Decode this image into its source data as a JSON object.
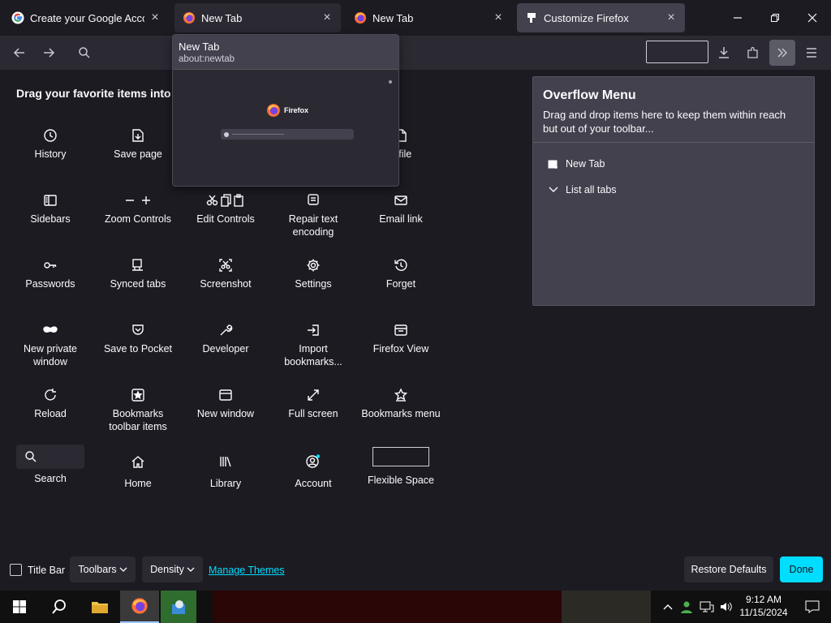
{
  "tabs": [
    {
      "label": "Create your Google Account",
      "icon": "google-icon",
      "state": "normal"
    },
    {
      "label": "New Tab",
      "icon": "firefox-icon",
      "state": "hover"
    },
    {
      "label": "New Tab",
      "icon": "firefox-icon",
      "state": "normal"
    },
    {
      "label": "Customize Firefox",
      "icon": "puzzle-icon",
      "state": "selected"
    }
  ],
  "tab_close": "×",
  "preview": {
    "title": "New Tab",
    "url": "about:newtab",
    "brand": "Firefox"
  },
  "palette": {
    "title": "Drag your favorite items into th",
    "items": [
      {
        "label": "History",
        "icon": "clock-icon"
      },
      {
        "label": "Save page",
        "icon": "save-page-icon"
      },
      {
        "label": "n file",
        "icon": "open-file-icon"
      },
      {
        "label": "Sidebars",
        "icon": "sidebar-icon"
      },
      {
        "label": "Zoom Controls",
        "icon": "zoom-icon"
      },
      {
        "label": "Edit Controls",
        "icon": "edit-icon"
      },
      {
        "label": "Repair text encoding",
        "icon": "text-encoding-icon"
      },
      {
        "label": "Email link",
        "icon": "email-icon"
      },
      {
        "label": "Passwords",
        "icon": "key-icon"
      },
      {
        "label": "Synced tabs",
        "icon": "synced-tabs-icon"
      },
      {
        "label": "Screenshot",
        "icon": "screenshot-icon"
      },
      {
        "label": "Settings",
        "icon": "gear-icon"
      },
      {
        "label": "Forget",
        "icon": "forget-icon"
      },
      {
        "label": "New private window",
        "icon": "mask-icon"
      },
      {
        "label": "Save to Pocket",
        "icon": "pocket-icon"
      },
      {
        "label": "Developer",
        "icon": "wrench-icon"
      },
      {
        "label": "Import bookmarks...",
        "icon": "import-icon"
      },
      {
        "label": "Firefox View",
        "icon": "firefox-view-icon"
      },
      {
        "label": "Reload",
        "icon": "reload-icon"
      },
      {
        "label": "Bookmarks toolbar items",
        "icon": "bookmark-star-icon"
      },
      {
        "label": "New window",
        "icon": "window-icon"
      },
      {
        "label": "Full screen",
        "icon": "fullscreen-icon"
      },
      {
        "label": "Bookmarks menu",
        "icon": "bookmarks-menu-icon"
      },
      {
        "label": "Search",
        "icon": "search-icon"
      },
      {
        "label": "Home",
        "icon": "home-icon"
      },
      {
        "label": "Library",
        "icon": "library-icon"
      },
      {
        "label": "Account",
        "icon": "account-icon"
      },
      {
        "label": "Flexible Space",
        "icon": "flexible-space-icon"
      }
    ]
  },
  "overflow": {
    "title": "Overflow Menu",
    "description": "Drag and drop items here to keep them within reach but out of your toolbar...",
    "items": [
      {
        "label": "New Tab",
        "icon": "new-tab-icon"
      },
      {
        "label": "List all tabs",
        "icon": "chevron-down-icon"
      }
    ]
  },
  "bottom": {
    "title_bar": "Title Bar",
    "toolbars": "Toolbars",
    "density": "Density",
    "manage_themes": "Manage Themes",
    "restore_defaults": "Restore Defaults",
    "done": "Done"
  },
  "taskbar": {
    "time": "9:12 AM",
    "date": "11/15/2024"
  },
  "colors": {
    "accent": "#00ddff",
    "background": "#1c1b22",
    "toolbar": "#2b2a33",
    "panel": "#42414d"
  }
}
